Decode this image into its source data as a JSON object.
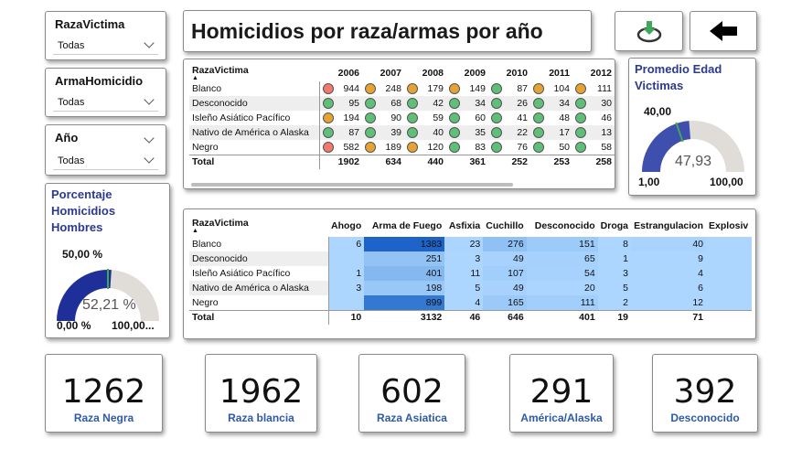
{
  "slicers": [
    {
      "title": "RazaVictima",
      "value": "Todas"
    },
    {
      "title": "ArmaHomicidio",
      "value": "Todas"
    },
    {
      "title": "Año",
      "value": "Todas"
    }
  ],
  "header": {
    "title": "Homicidios por raza/armas por año"
  },
  "colors": {
    "red": "#f07a6e",
    "orange": "#e6a232",
    "green": "#5fbf78",
    "gaugeBlue": "#3f4fae",
    "gaugeNavy": "#1f2f9a",
    "gaugeGray": "#e0dcd8",
    "target": "#3ea85a"
  },
  "table_years": {
    "header": [
      "RazaVictima",
      "2006",
      "2007",
      "2008",
      "2009",
      "2010",
      "2011",
      "2012"
    ],
    "rows": [
      {
        "name": "Blanco",
        "cells": [
          {
            "v": "944",
            "c": "red"
          },
          {
            "v": "248",
            "c": "orange"
          },
          {
            "v": "179",
            "c": "orange"
          },
          {
            "v": "149",
            "c": "orange"
          },
          {
            "v": "87",
            "c": "green"
          },
          {
            "v": "104",
            "c": "orange"
          },
          {
            "v": "111",
            "c": "orange"
          }
        ]
      },
      {
        "name": "Desconocido",
        "cells": [
          {
            "v": "95",
            "c": "green"
          },
          {
            "v": "68",
            "c": "green"
          },
          {
            "v": "42",
            "c": "green"
          },
          {
            "v": "34",
            "c": "green"
          },
          {
            "v": "26",
            "c": "green"
          },
          {
            "v": "34",
            "c": "green"
          },
          {
            "v": "30",
            "c": "green"
          }
        ]
      },
      {
        "name": "Isleño Asiático Pacífico",
        "cells": [
          {
            "v": "194",
            "c": "orange"
          },
          {
            "v": "90",
            "c": "green"
          },
          {
            "v": "59",
            "c": "green"
          },
          {
            "v": "60",
            "c": "green"
          },
          {
            "v": "41",
            "c": "green"
          },
          {
            "v": "48",
            "c": "green"
          },
          {
            "v": "46",
            "c": "green"
          }
        ]
      },
      {
        "name": "Nativo de América o Alaska",
        "cells": [
          {
            "v": "87",
            "c": "green"
          },
          {
            "v": "39",
            "c": "green"
          },
          {
            "v": "40",
            "c": "green"
          },
          {
            "v": "35",
            "c": "green"
          },
          {
            "v": "22",
            "c": "green"
          },
          {
            "v": "17",
            "c": "green"
          },
          {
            "v": "13",
            "c": "green"
          }
        ]
      },
      {
        "name": "Negro",
        "cells": [
          {
            "v": "582",
            "c": "red"
          },
          {
            "v": "189",
            "c": "orange"
          },
          {
            "v": "120",
            "c": "orange"
          },
          {
            "v": "83",
            "c": "green"
          },
          {
            "v": "76",
            "c": "green"
          },
          {
            "v": "50",
            "c": "green"
          },
          {
            "v": "58",
            "c": "green"
          }
        ]
      }
    ],
    "total": {
      "name": "Total",
      "cells": [
        "1902",
        "634",
        "440",
        "361",
        "252",
        "253",
        "258"
      ]
    }
  },
  "table_weapons": {
    "header": [
      "RazaVictima",
      "Ahogo",
      "Arma de Fuego",
      "Asfixia",
      "Cuchillo",
      "Desconocido",
      "Droga",
      "Estrangulacion",
      "Explosiv"
    ],
    "rows": [
      {
        "name": "Blanco",
        "cells": [
          "6",
          "1383",
          "23",
          "276",
          "151",
          "8",
          "40",
          ""
        ]
      },
      {
        "name": "Desconocido",
        "cells": [
          "",
          "251",
          "3",
          "49",
          "65",
          "1",
          "9",
          ""
        ]
      },
      {
        "name": "Isleño Asiático Pacífico",
        "cells": [
          "1",
          "401",
          "11",
          "107",
          "54",
          "3",
          "4",
          ""
        ]
      },
      {
        "name": "Nativo de América o Alaska",
        "cells": [
          "3",
          "198",
          "5",
          "49",
          "20",
          "5",
          "6",
          ""
        ]
      },
      {
        "name": "Negro",
        "cells": [
          "",
          "899",
          "4",
          "165",
          "111",
          "2",
          "12",
          ""
        ]
      }
    ],
    "total": {
      "name": "Total",
      "cells": [
        "10",
        "3132",
        "46",
        "646",
        "401",
        "19",
        "71",
        ""
      ]
    }
  },
  "gauge_age": {
    "title_line1": "Promedio Edad",
    "title_line2": "Victimas",
    "target_label": "40,00",
    "value": "47,93",
    "min": "1,00",
    "max": "100,00",
    "value_num": 47.93,
    "min_num": 1,
    "max_num": 100,
    "target_num": 40
  },
  "gauge_male": {
    "title_line1": "Porcentaje",
    "title_line2": "Homicidios",
    "title_line3": "Hombres",
    "target_label": "50,00 %",
    "value": "52,21 %",
    "min": "0,00 %",
    "max": "100,00...",
    "value_num": 52.21,
    "min_num": 0,
    "max_num": 100,
    "target_num": 50
  },
  "kpis": [
    {
      "value": "1262",
      "label": "Raza Negra"
    },
    {
      "value": "1962",
      "label": "Raza blancia"
    },
    {
      "value": "602",
      "label": "Raza Asiatica"
    },
    {
      "value": "291",
      "label": "América/Alaska"
    },
    {
      "value": "392",
      "label": "Desconocido"
    }
  ]
}
